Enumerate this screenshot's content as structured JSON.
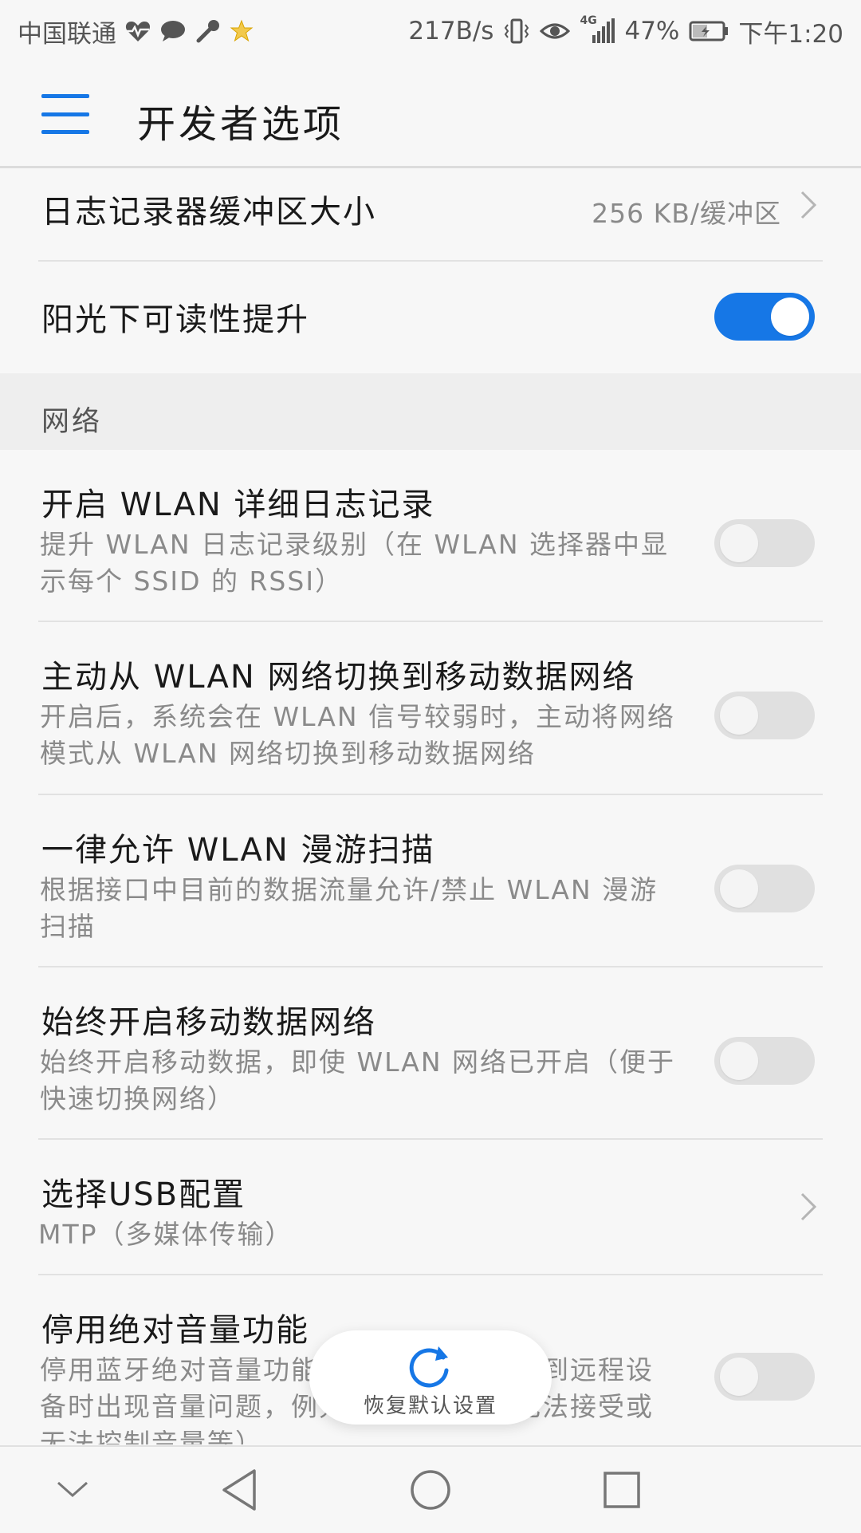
{
  "status_bar": {
    "carrier": "中国联通",
    "net_speed": "217B/s",
    "network_type": "4G",
    "battery": "47%",
    "time": "下午1:20",
    "icons": [
      "heart-pulse-icon",
      "chat-bubble-icon",
      "key-icon",
      "star-badge-icon",
      "vibrate-icon",
      "eye-icon",
      "signal-icon",
      "battery-icon"
    ]
  },
  "header": {
    "title": "开发者选项",
    "menu_icon": "hamburger-menu-icon"
  },
  "rows": {
    "log_buffer": {
      "title": "日志记录器缓冲区大小",
      "value": "256 KB/缓冲区"
    },
    "sunlight": {
      "title": "阳光下可读性提升",
      "enabled": true
    }
  },
  "section_network": {
    "label": "网络"
  },
  "network_items": [
    {
      "title": "开启 WLAN 详细日志记录",
      "desc": "提升 WLAN 日志记录级别（在 WLAN 选择器中显示每个 SSID 的 RSSI）",
      "enabled": false
    },
    {
      "title": "主动从 WLAN 网络切换到移动数据网络",
      "desc": "开启后，系统会在 WLAN 信号较弱时，主动将网络模式从 WLAN 网络切换到移动数据网络",
      "enabled": false
    },
    {
      "title": "一律允许 WLAN 漫游扫描",
      "desc": "根据接口中目前的数据流量允许/禁止 WLAN 漫游扫描",
      "enabled": false
    },
    {
      "title": "始终开启移动数据网络",
      "desc": "始终开启移动数据，即使 WLAN 网络已开启（便于快速切换网络）",
      "enabled": false
    }
  ],
  "usb_config": {
    "title": "选择USB配置",
    "value": "MTP（多媒体传输）"
  },
  "absolute_volume": {
    "title": "停用绝对音量功能",
    "desc": "停用蓝牙绝对音量功能，即可避免在连接到远程设备时出现音量问题，例如音量高得让人无法接受或无法控制音量等）",
    "enabled": false
  },
  "restore_button": {
    "label": "恢复默认设置"
  },
  "colors": {
    "accent": "#1677e6",
    "background": "#f7f7f7",
    "section_bg": "#eeeeee",
    "secondary_text": "#8a8a8a"
  }
}
